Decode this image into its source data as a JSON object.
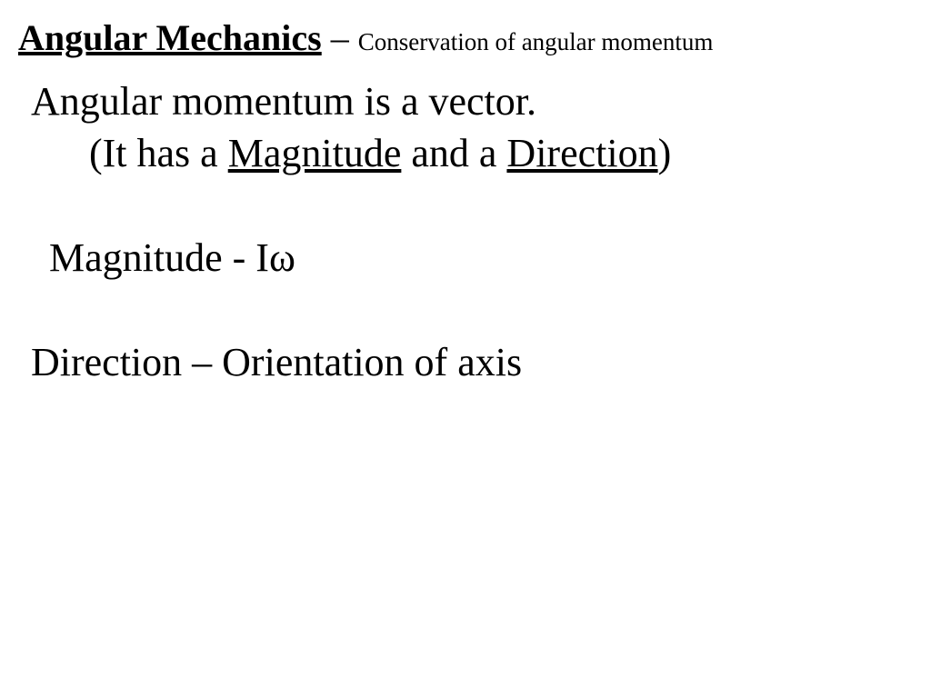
{
  "title": {
    "main": "Angular Mechanics",
    "dash": " – ",
    "sub": "Conservation of angular momentum"
  },
  "content": {
    "line1": "Angular momentum is a vector.",
    "line2_open": "(It has a ",
    "line2_u1": "Magnitude",
    "line2_mid": " and a ",
    "line2_u2": "Direction",
    "line2_close": ")",
    "line3_pre": "Magnitude - I",
    "line3_omega": "ω",
    "line4": "Direction – Orientation of axis"
  }
}
